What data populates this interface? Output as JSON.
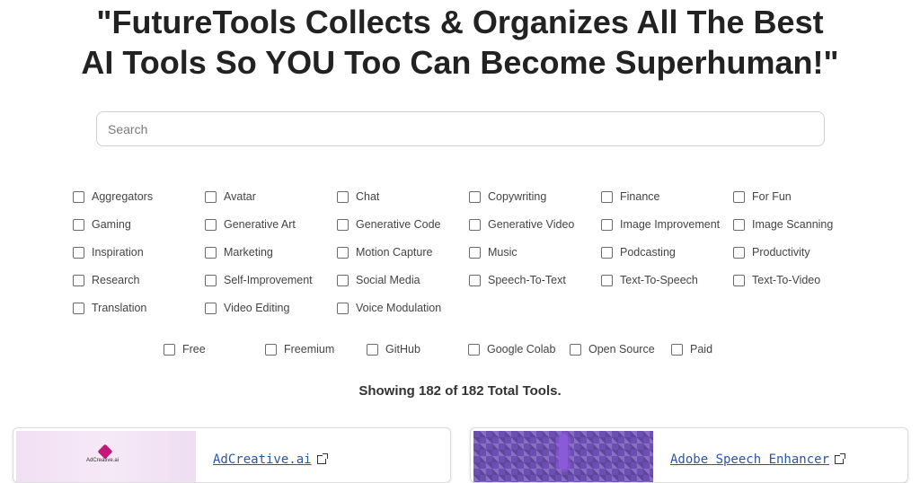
{
  "header": {
    "line1": "\"FutureTools Collects & Organizes All The Best",
    "line2": "AI Tools So YOU Too Can Become Superhuman!\""
  },
  "search": {
    "placeholder": "Search",
    "value": ""
  },
  "categories": [
    "Aggregators",
    "Avatar",
    "Chat",
    "Copywriting",
    "Finance",
    "For Fun",
    "Gaming",
    "Generative Art",
    "Generative Code",
    "Generative Video",
    "Image Improvement",
    "Image Scanning",
    "Inspiration",
    "Marketing",
    "Motion Capture",
    "Music",
    "Podcasting",
    "Productivity",
    "Research",
    "Self-Improvement",
    "Social Media",
    "Speech-To-Text",
    "Text-To-Speech",
    "Text-To-Video",
    "Translation",
    "Video Editing",
    "Voice Modulation"
  ],
  "pricing": [
    "Free",
    "Freemium",
    "GitHub",
    "Google Colab",
    "Open Source",
    "Paid"
  ],
  "status": {
    "showing": "Showing 182 of 182 Total Tools."
  },
  "cards": [
    {
      "title": "AdCreative.ai",
      "logo_text": "AdCreative.ai"
    },
    {
      "title": "Adobe Speech Enhancer"
    }
  ],
  "colors": {
    "link": "#2b55a8",
    "logo_accent": "#c2187a",
    "thumb2": "#6d4fb3"
  }
}
